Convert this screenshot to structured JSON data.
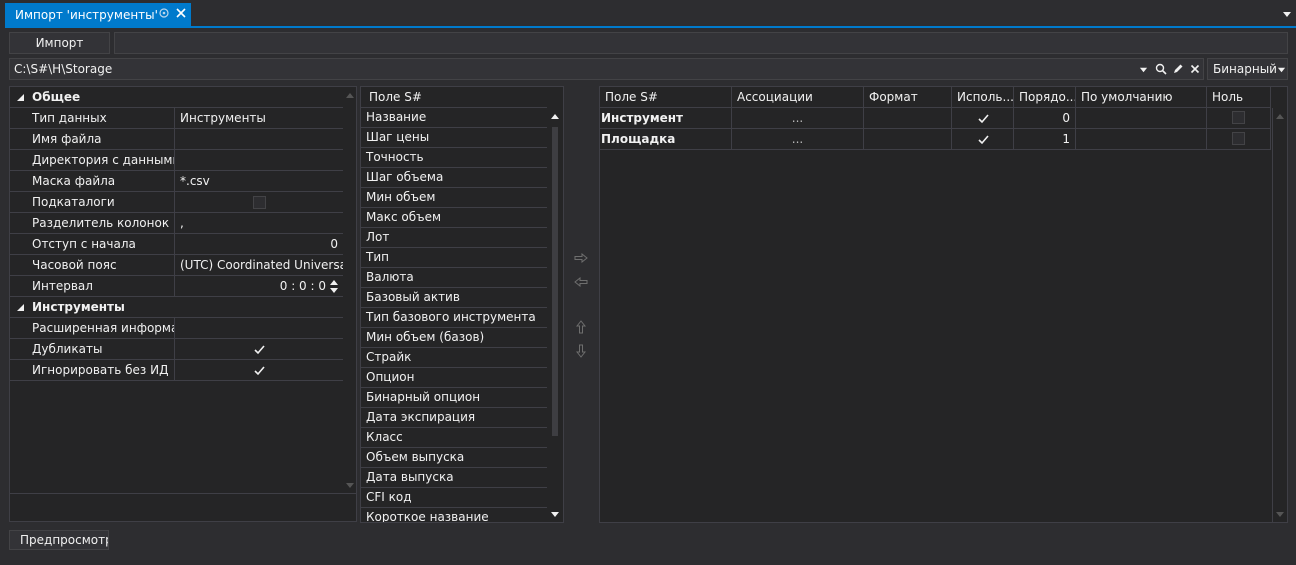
{
  "window": {
    "tab_title": "Импорт 'инструменты'"
  },
  "toolbar": {
    "import_label": "Импорт",
    "preview_label": "Предпросмотр"
  },
  "path": {
    "value": "C:\\S#\\H\\Storage"
  },
  "format": {
    "selected": "Бинарный"
  },
  "properties": {
    "general": {
      "title": "Общее",
      "rows": [
        {
          "name": "Тип данных",
          "value": "Инструменты"
        },
        {
          "name": "Имя файла",
          "value": ""
        },
        {
          "name": "Директория с данными",
          "value": ""
        },
        {
          "name": "Маска файла",
          "value": "*.csv"
        },
        {
          "name": "Подкаталоги",
          "value": ""
        },
        {
          "name": "Разделитель колонок",
          "value": ","
        },
        {
          "name": "Отступ с начала",
          "value": "0"
        },
        {
          "name": "Часовой пояс",
          "value": "(UTC) Coordinated Universa..."
        },
        {
          "name": "Интервал",
          "value": "0 : 0 : 0"
        }
      ]
    },
    "instruments": {
      "title": "Инструменты",
      "rows": [
        {
          "name": "Расширенная информа...",
          "value": ""
        },
        {
          "name": "Дубликаты",
          "value": ""
        },
        {
          "name": "Игнорировать без ИД",
          "value": ""
        }
      ]
    }
  },
  "fields_list": {
    "header": "Поле S#",
    "items": [
      "Название",
      "Шаг цены",
      "Точность",
      "Шаг объема",
      "Мин объем",
      "Макс объем",
      "Лот",
      "Тип",
      "Валюта",
      "Базовый актив",
      "Тип базового инструмента",
      "Мин объем (базов)",
      "Страйк",
      "Опцион",
      "Бинарный опцион",
      "Дата экспирация",
      "Класс",
      "Объем выпуска",
      "Дата выпуска",
      "CFI код",
      "Короткое название"
    ]
  },
  "mapping": {
    "columns": [
      "Поле S#",
      "Ассоциации",
      "Формат",
      "Исполь...",
      "Порядо...",
      "По умолчанию",
      "Ноль"
    ],
    "rows": [
      {
        "field": "Инструмент",
        "assoc": "...",
        "format": "",
        "used": true,
        "order": "0",
        "default": ""
      },
      {
        "field": "Площадка",
        "assoc": "...",
        "format": "",
        "used": true,
        "order": "1",
        "default": ""
      }
    ]
  },
  "icons": {
    "tab_pin": "pin-icon",
    "tab_close": "close-icon",
    "tab_menu": "chevron-down-icon",
    "path_dropdown": "chevron-down-icon",
    "path_search": "search-icon",
    "path_edit": "pencil-icon",
    "path_clear": "close-icon",
    "move_right": "arrow-right-icon",
    "move_left": "arrow-left-icon",
    "move_up": "arrow-up-icon",
    "move_down": "arrow-down-icon"
  },
  "colors": {
    "accent": "#007acc",
    "background": "#2d2d30",
    "panel": "#252526",
    "border": "#3f3f46"
  }
}
